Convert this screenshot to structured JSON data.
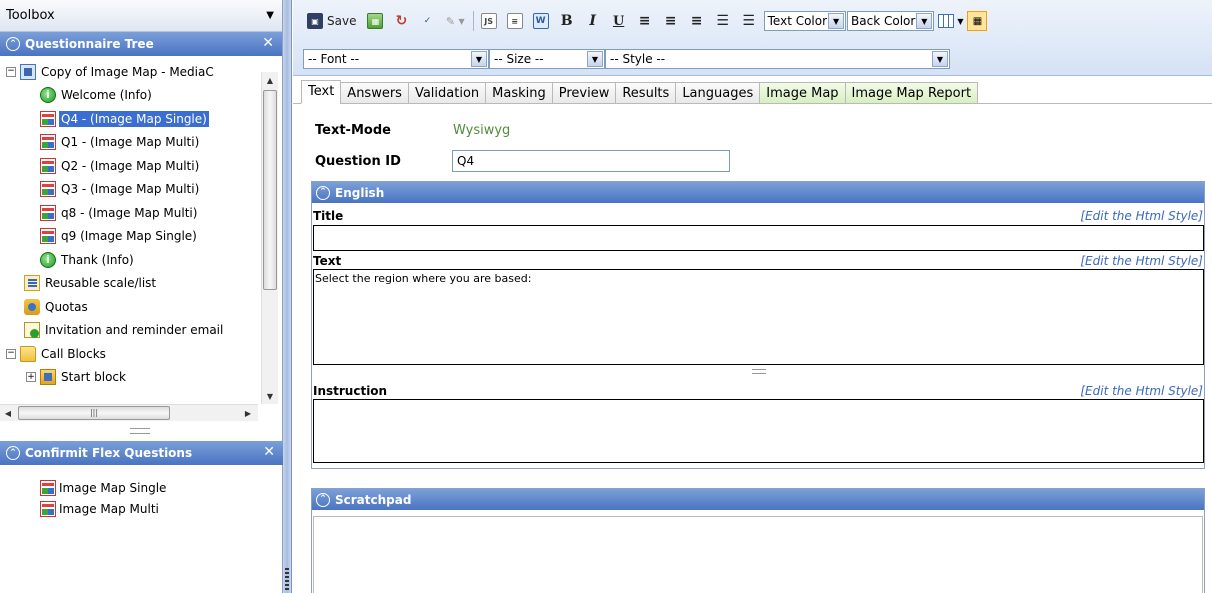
{
  "toolbox": {
    "title": "Toolbox"
  },
  "questionnaire_tree": {
    "title": "Questionnaire Tree",
    "root_label": "Copy of Image Map - MediaC",
    "items": [
      {
        "label": "Welcome (Info)",
        "icon": "info-icon"
      },
      {
        "label": "Q4 - (Image Map Single)",
        "icon": "image-map-icon",
        "selected": true
      },
      {
        "label": "Q1 - (Image Map Multi)",
        "icon": "image-map-icon"
      },
      {
        "label": "Q2 - (Image Map Multi)",
        "icon": "image-map-icon"
      },
      {
        "label": "Q3 - (Image Map Multi)",
        "icon": "image-map-icon"
      },
      {
        "label": "q8 - (Image Map Multi)",
        "icon": "image-map-icon"
      },
      {
        "label": "q9 (Image Map Single)",
        "icon": "image-map-icon"
      },
      {
        "label": "Thank (Info)",
        "icon": "info-icon"
      }
    ],
    "top_level": [
      {
        "label": "Reusable scale/list"
      },
      {
        "label": "Quotas"
      },
      {
        "label": "Invitation and reminder email"
      },
      {
        "label": "Call Blocks"
      },
      {
        "label": "Start block"
      }
    ]
  },
  "flex_questions": {
    "title": "Confirmit Flex Questions",
    "items": [
      {
        "label": "Image Map Single"
      },
      {
        "label": "Image Map Multi"
      }
    ]
  },
  "toolbar": {
    "save_label": "Save",
    "text_color_label": "Text Color",
    "back_color_label": "Back Color",
    "font_placeholder": "-- Font --",
    "size_placeholder": "-- Size --",
    "style_placeholder": "-- Style --"
  },
  "tabs": [
    {
      "label": "Text",
      "active": true
    },
    {
      "label": "Answers"
    },
    {
      "label": "Validation"
    },
    {
      "label": "Masking"
    },
    {
      "label": "Preview"
    },
    {
      "label": "Results"
    },
    {
      "label": "Languages"
    },
    {
      "label": "Image Map",
      "green": true
    },
    {
      "label": "Image Map Report",
      "green": true
    }
  ],
  "form": {
    "text_mode_label": "Text-Mode",
    "text_mode_value": "Wysiwyg",
    "question_id_label": "Question ID",
    "question_id_value": "Q4"
  },
  "language_section": {
    "title": "English",
    "title_field_label": "Title",
    "title_field_value": "",
    "text_field_label": "Text",
    "text_field_value": "Select the region where you are based:",
    "instruction_field_label": "Instruction",
    "instruction_field_value": "",
    "edit_style_link": "[Edit the Html Style]"
  },
  "scratchpad": {
    "title": "Scratchpad",
    "value": ""
  },
  "colors": {
    "panel_header": "#4a74c2",
    "selection": "#3a6fd1",
    "link": "#3a68c2",
    "wysiwyg_value": "#4f8c3a"
  }
}
